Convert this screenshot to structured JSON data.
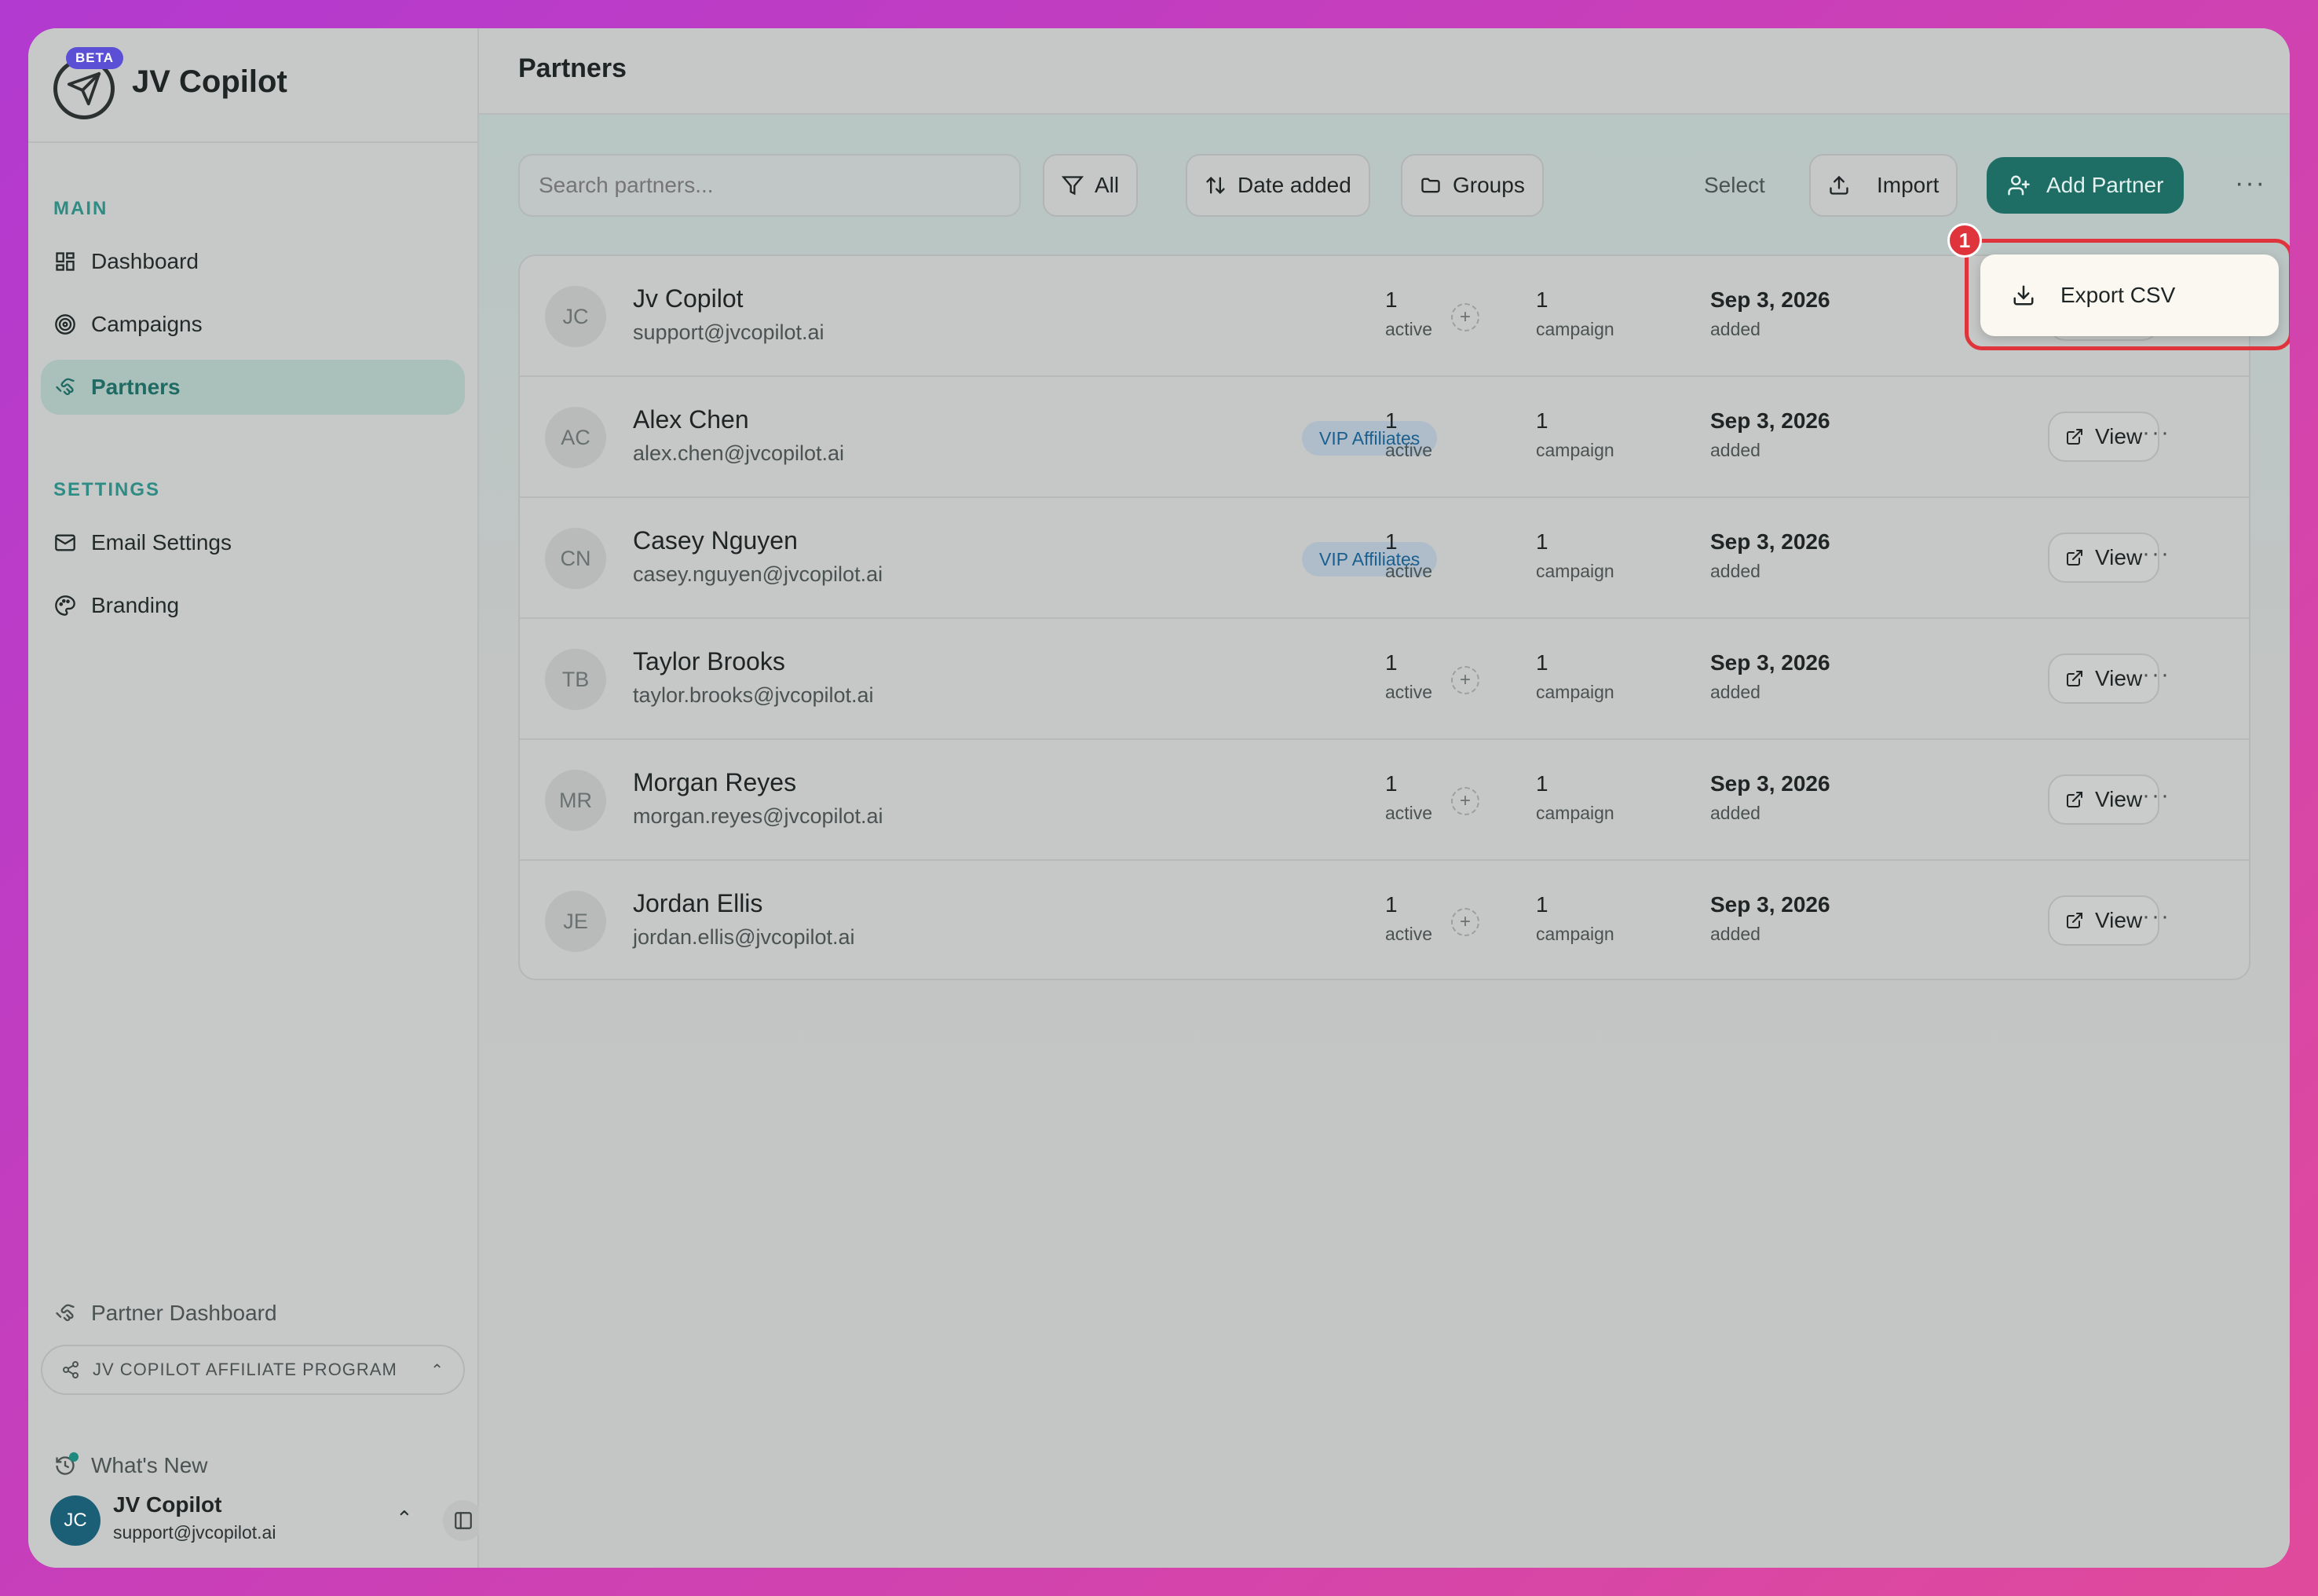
{
  "app": {
    "name": "JV Copilot",
    "beta_label": "BETA"
  },
  "sidebar": {
    "main_label": "MAIN",
    "settings_label": "SETTINGS",
    "main_items": [
      {
        "label": "Dashboard",
        "icon": "dashboard-icon"
      },
      {
        "label": "Campaigns",
        "icon": "target-icon"
      },
      {
        "label": "Partners",
        "icon": "handshake-icon",
        "active": true
      }
    ],
    "settings_items": [
      {
        "label": "Email Settings",
        "icon": "mail-icon"
      },
      {
        "label": "Branding",
        "icon": "palette-icon"
      }
    ],
    "partner_dashboard": "Partner Dashboard",
    "program": "JV COPILOT AFFILIATE PROGRAM",
    "whats_new": "What's New",
    "user": {
      "initials": "JC",
      "name": "JV Copilot",
      "email": "support@jvcopilot.ai"
    }
  },
  "header": {
    "title": "Partners"
  },
  "toolbar": {
    "search_placeholder": "Search partners...",
    "filter_label": "All",
    "sort_label": "Date added",
    "groups_label": "Groups",
    "select_label": "Select",
    "import_label": "Import",
    "add_partner_label": "Add Partner"
  },
  "dropdown": {
    "export_label": "Export CSV",
    "step": "1"
  },
  "partners": [
    {
      "initials": "JC",
      "name": "Jv Copilot",
      "email": "support@jvcopilot.ai",
      "group": "",
      "active_count": "1",
      "active_label": "active",
      "campaign_count": "1",
      "campaign_label": "campaign",
      "date": "Sep 3, 2026",
      "date_label": "added",
      "view": "View"
    },
    {
      "initials": "AC",
      "name": "Alex Chen",
      "email": "alex.chen@jvcopilot.ai",
      "group": "VIP Affiliates",
      "active_count": "1",
      "active_label": "active",
      "campaign_count": "1",
      "campaign_label": "campaign",
      "date": "Sep 3, 2026",
      "date_label": "added",
      "view": "View"
    },
    {
      "initials": "CN",
      "name": "Casey Nguyen",
      "email": "casey.nguyen@jvcopilot.ai",
      "group": "VIP Affiliates",
      "active_count": "1",
      "active_label": "active",
      "campaign_count": "1",
      "campaign_label": "campaign",
      "date": "Sep 3, 2026",
      "date_label": "added",
      "view": "View"
    },
    {
      "initials": "TB",
      "name": "Taylor Brooks",
      "email": "taylor.brooks@jvcopilot.ai",
      "group": "",
      "active_count": "1",
      "active_label": "active",
      "campaign_count": "1",
      "campaign_label": "campaign",
      "date": "Sep 3, 2026",
      "date_label": "added",
      "view": "View"
    },
    {
      "initials": "MR",
      "name": "Morgan Reyes",
      "email": "morgan.reyes@jvcopilot.ai",
      "group": "",
      "active_count": "1",
      "active_label": "active",
      "campaign_count": "1",
      "campaign_label": "campaign",
      "date": "Sep 3, 2026",
      "date_label": "added",
      "view": "View"
    },
    {
      "initials": "JE",
      "name": "Jordan Ellis",
      "email": "jordan.ellis@jvcopilot.ai",
      "group": "",
      "active_count": "1",
      "active_label": "active",
      "campaign_count": "1",
      "campaign_label": "campaign",
      "date": "Sep 3, 2026",
      "date_label": "added",
      "view": "View"
    }
  ],
  "colors": {
    "accent": "#1e6e66",
    "highlight": "#e0343c",
    "beta": "#5b4fd6"
  }
}
